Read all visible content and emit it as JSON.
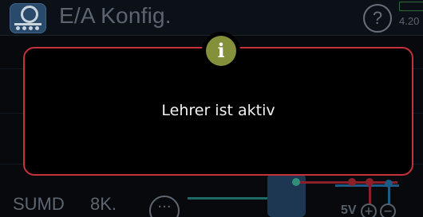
{
  "header": {
    "title": "E/A Konfig.",
    "version": "4.20",
    "help_icon": "question-circle-icon",
    "app_icon": "io-port-icon"
  },
  "bottom_bar": {
    "tabs": [
      "SUMD",
      "8K."
    ],
    "more_icon": "ellipsis-circle-icon",
    "port_voltage": "5V",
    "plus_symbol": "+",
    "minus_symbol": "−"
  },
  "dialog": {
    "icon": "info-icon",
    "icon_glyph": "i",
    "message": "Lehrer ist aktiv"
  },
  "colors": {
    "dialog_border": "#c6323a",
    "info_badge": "#84913a",
    "wire_red": "#8b2028",
    "wire_blue": "#1f5a86",
    "wire_teal": "#1c7b71"
  }
}
